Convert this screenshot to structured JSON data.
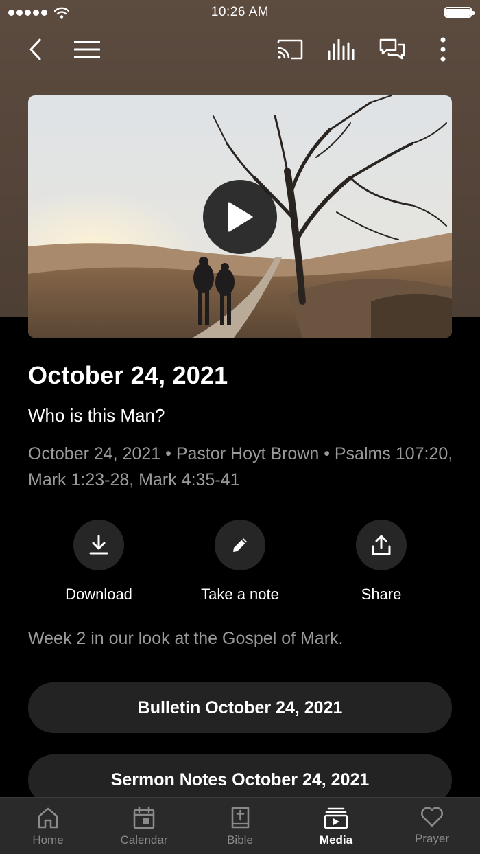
{
  "status_bar": {
    "time": "10:26 AM"
  },
  "sermon": {
    "title": "October 24, 2021",
    "subtitle": "Who is this Man?",
    "meta": "October 24, 2021 • Pastor Hoyt Brown • Psalms 107:20, Mark 1:23-28, Mark 4:35-41",
    "description": "Week 2 in our look at the Gospel of Mark."
  },
  "actions": [
    {
      "label": "Download",
      "icon": "download-icon"
    },
    {
      "label": "Take a note",
      "icon": "pencil-icon"
    },
    {
      "label": "Share",
      "icon": "share-icon"
    }
  ],
  "resources": [
    {
      "label": "Bulletin October 24, 2021"
    },
    {
      "label": "Sermon Notes October 24, 2021"
    }
  ],
  "tabs": [
    {
      "label": "Home",
      "icon": "home-icon"
    },
    {
      "label": "Calendar",
      "icon": "calendar-icon"
    },
    {
      "label": "Bible",
      "icon": "bible-icon"
    },
    {
      "label": "Media",
      "icon": "media-icon",
      "active": true
    },
    {
      "label": "Prayer",
      "icon": "heart-icon"
    }
  ],
  "colors": {
    "header_brown": "#5c4b3f",
    "background": "#000000",
    "muted_text": "#9a9a9a",
    "pill": "#232323",
    "tabbar": "#2a2a2a"
  }
}
